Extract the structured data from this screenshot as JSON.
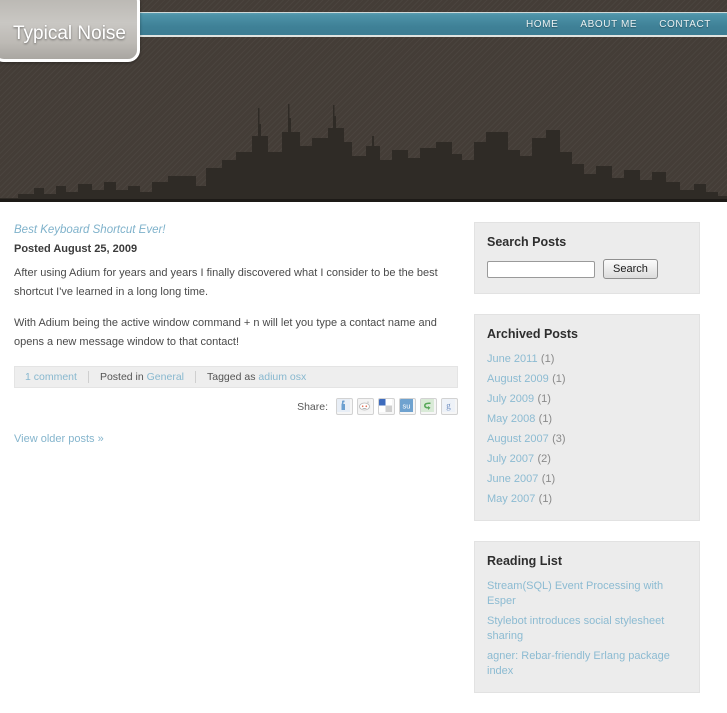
{
  "header": {
    "site_title": "Typical Noise",
    "nav": [
      {
        "label": "HOME"
      },
      {
        "label": "ABOUT ME"
      },
      {
        "label": "CONTACT"
      }
    ],
    "bg_color": "#463f39",
    "nav_color": "#3f8197",
    "skyline_color": "#2f2b26"
  },
  "post": {
    "title": "Best Keyboard Shortcut Ever!",
    "date_label": "Posted August 25, 2009",
    "paragraphs": [
      "After using Adium for years and years I finally discovered what I consider to be the best shortcut I've learned in a long long time.",
      "With Adium being the active window command + n will let you type a contact name and opens a new message window to that contact!"
    ],
    "meta": {
      "comments_label": "1 comment",
      "posted_in_prefix": "Posted in",
      "category": "General",
      "tagged_prefix": "Tagged as",
      "tags": "adium osx"
    },
    "share": {
      "label": "Share:",
      "icons": [
        {
          "name": "facebook-icon"
        },
        {
          "name": "reddit-icon"
        },
        {
          "name": "delicious-icon"
        },
        {
          "name": "stumbleupon-icon"
        },
        {
          "name": "technorati-icon"
        },
        {
          "name": "google-icon"
        }
      ]
    },
    "older_posts_label": "View older posts »"
  },
  "sidebar": {
    "search": {
      "title": "Search Posts",
      "input_value": "",
      "placeholder": "",
      "button_label": "Search"
    },
    "archives": {
      "title": "Archived Posts",
      "items": [
        {
          "label": "June 2011",
          "count": "(1)"
        },
        {
          "label": "August 2009",
          "count": "(1)"
        },
        {
          "label": "July 2009",
          "count": "(1)"
        },
        {
          "label": "May 2008",
          "count": "(1)"
        },
        {
          "label": "August 2007",
          "count": "(3)"
        },
        {
          "label": "July 2007",
          "count": "(2)"
        },
        {
          "label": "June 2007",
          "count": "(1)"
        },
        {
          "label": "May 2007",
          "count": "(1)"
        }
      ]
    },
    "reading_list": {
      "title": "Reading List",
      "items": [
        {
          "label": "Stream(SQL) Event Processing with Esper"
        },
        {
          "label": "Stylebot introduces social stylesheet sharing"
        },
        {
          "label": "agner: Rebar-friendly Erlang package index"
        }
      ]
    }
  },
  "colors": {
    "link": "#88b8cf",
    "teal": "#3f8197",
    "header": "#463f39",
    "widget_bg": "#ececec"
  }
}
